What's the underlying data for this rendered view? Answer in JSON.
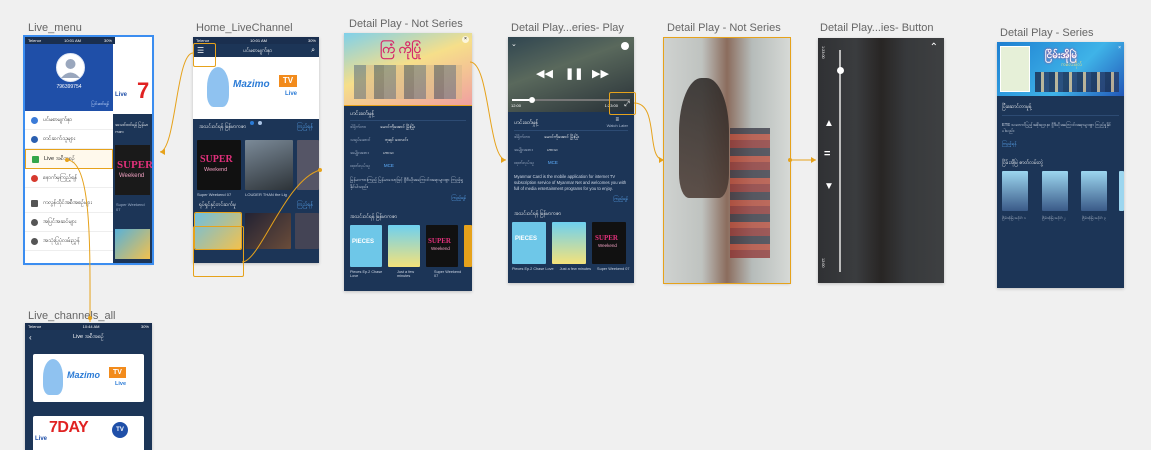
{
  "artboards": {
    "live_menu": "Live_menu",
    "home_live": "Home_LiveChannel",
    "detail_not_series_1": "Detail Play - Not Series",
    "detail_series_play": "Detail Play...eries- Play",
    "detail_not_series_2": "Detail Play - Not Series",
    "detail_series_button": "Detail Play...ies- Button",
    "detail_series": "Detail Play - Series",
    "live_channels_all": "Live_channels_all"
  },
  "status": {
    "carrier": "Telenor",
    "time": "10:01 AM",
    "time2": "10:44 AM",
    "battery": "30%"
  },
  "live_menu": {
    "phone": "796399754",
    "edit_label": "ပြင်ဆင်ရန်",
    "items": [
      "ပင်မစာမျက်နှာ",
      "တင်ဆက်သူများ",
      "Live အစီအစဉ်",
      "နောက်မှကြည့်ရန်",
      "ကလွန်ထိုင်အစီအစဉ်များ",
      "အပြင်အဆင်များ",
      "အသုံးပြုပုံလမ်းညွှန်"
    ],
    "peek": {
      "live_badge": "Live",
      "section": "အသင်းဝင်ရန် မြန်မာကဇာ",
      "super": "SUPER",
      "weekend": "Weekend",
      "caption": "Super Weekend 07"
    }
  },
  "home_live": {
    "header": "ပင်မစာမျက်နှာ",
    "brand": "Mazimo",
    "brand_tv": "TV",
    "brand_live": "Live",
    "section1": "အသင်းဝင်ရန် မြန်မာကဇာ",
    "more": "ကြည့်ရန်",
    "cap1": "Super Weekend 07",
    "cap2": "LOUDER THAN the Lig",
    "section2": "ရုပ်ရှင်နှင့်တင်ဆက်မှု",
    "super": "SUPER",
    "weekend": "Weekend"
  },
  "detail1": {
    "poster_title": "ကြံ ကိုပြုံ",
    "program": "ဟင်းခတ်မှုန့်",
    "rows": [
      {
        "k": "ဒါရိုက်တာ",
        "v": "မောင်ကိုအောင် မြိုးမြိုး"
      },
      {
        "k": "သရုပ်ဆောင်",
        "v": "ဘုရင် ဝေလင်း"
      },
      {
        "k": "အမျိုးအစား",
        "v": "ဟာသ"
      },
      {
        "k": "ထုတ်လုပ်သူ",
        "v": "MCE"
      }
    ],
    "desc": "မြန်မာကားကြည့် မြန်မာသော့ဖြင့် ဗွီဒီယိုအကြောင်းအရာများစွာ ကြည့်ရှုနိုင်ပါသည်။",
    "more": "ကြည့်ရန်",
    "section": "အသင်းဝင်ရန် မြန်မာကဇာ",
    "cards": [
      "Pieces Ep.2 Chase Love",
      "Just a few minutes",
      "Super Weekend 07"
    ],
    "pieces": "PIECES",
    "super": "SUPER",
    "weekend": "Weekend"
  },
  "detail2": {
    "time_start": "12:00",
    "time_end": "1:23:00",
    "program": "ဟင်းခတ်မှုန့်",
    "watch_later": "Watch Later",
    "rows": [
      {
        "k": "ဒါရိုက်တာ",
        "v": "မောင်ကိုအောင် မြိုးမြိုး"
      },
      {
        "k": "အမျိုးအစား",
        "v": "ဟာသ"
      },
      {
        "k": "ထုတ်လုပ်သူ",
        "v": "MCE"
      }
    ],
    "desc": "Myanmar Card is the mobile application for internet TV subscription service of Myanmar Net and welcomes you with full of media entertainment programs for you to enjoy.",
    "more": "ကြည့်ရန်",
    "section": "အသင်းဝင်ရန် မြန်မာကဇာ",
    "cards": [
      "Pieces Ep.2 Chase Love",
      "Just a few minutes",
      "Super Weekend 07"
    ],
    "pieces": "PIECES",
    "super": "SUPER",
    "weekend": "Weekend"
  },
  "detail4": {
    "time_top": "1:23:00",
    "time_bottom": "12:00"
  },
  "detail5": {
    "poster_title": "ငြိမ်းအိုမြဲ",
    "poster_sub": "ကလေးဗိုလ်",
    "section_label": "ပြီးဆောင်တာမှုန့်",
    "desc": "ETE သဘောင်ပြည့်အစိုးရဌာနာ ဗွီဒီယိုအကြောင်းအရာများစွာ ကြည့်ရှုနိုင်ပါသည်။",
    "more": "ကြည့်ရန်",
    "episodes_title": "ငြိမ်းအိုမြဲ ဇာတ်လမ်းတွဲ",
    "episodes": [
      "ငြိမ်းအိုမြဲ အပိုင်း ၁",
      "ငြိမ်းအိုမြဲ အပိုင်း ၂",
      "ငြိမ်းအိုမြဲ အပိုင်း ၃",
      "ငြိမ်းအိုမြဲ အပိုင်း ၄"
    ]
  },
  "live_all": {
    "title": "Live အစီအစဉ်",
    "brand": "Mazimo",
    "brand_tv": "TV",
    "brand_live": "Live",
    "seven": "7DAY",
    "seven_tv": "TV",
    "live": "Live"
  }
}
